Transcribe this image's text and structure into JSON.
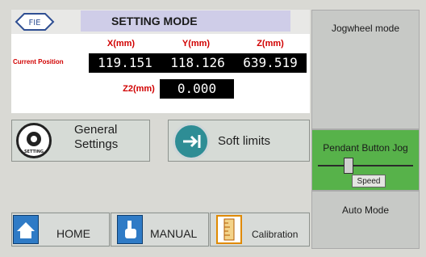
{
  "header": {
    "logo_text": "FIE",
    "title": "SETTING MODE"
  },
  "position": {
    "axis_labels": {
      "x": "X(mm)",
      "y": "Y(mm)",
      "z": "Z(mm)",
      "z2": "Z2(mm)"
    },
    "current_label": "Current Position",
    "values": {
      "x": "119.151",
      "y": "118.126",
      "z": "639.519",
      "z2": "0.000"
    }
  },
  "buttons": {
    "general": {
      "label": "General Settings",
      "icon": "gear-icon",
      "icon_caption": "SETTING"
    },
    "soft_limits": {
      "label": "Soft limits",
      "icon": "arrow-right-icon"
    }
  },
  "nav": {
    "home": {
      "label": "HOME",
      "icon": "home-icon"
    },
    "manual": {
      "label": "MANUAL",
      "icon": "hand-icon"
    },
    "calibration": {
      "label": "Calibration",
      "icon": "ruler-icon"
    }
  },
  "side": {
    "jog": {
      "label": "Jogwheel mode"
    },
    "pendant": {
      "label": "Pendant Button Jog",
      "speed_label": "Speed",
      "speed_level": 0.3
    },
    "auto": {
      "label": "Auto Mode"
    }
  },
  "colors": {
    "title_bar": "#cfcde8",
    "axis_red": "#d10000",
    "pendant_active": "#57b24a",
    "nav_icon_blue": "#2f7bc6"
  }
}
